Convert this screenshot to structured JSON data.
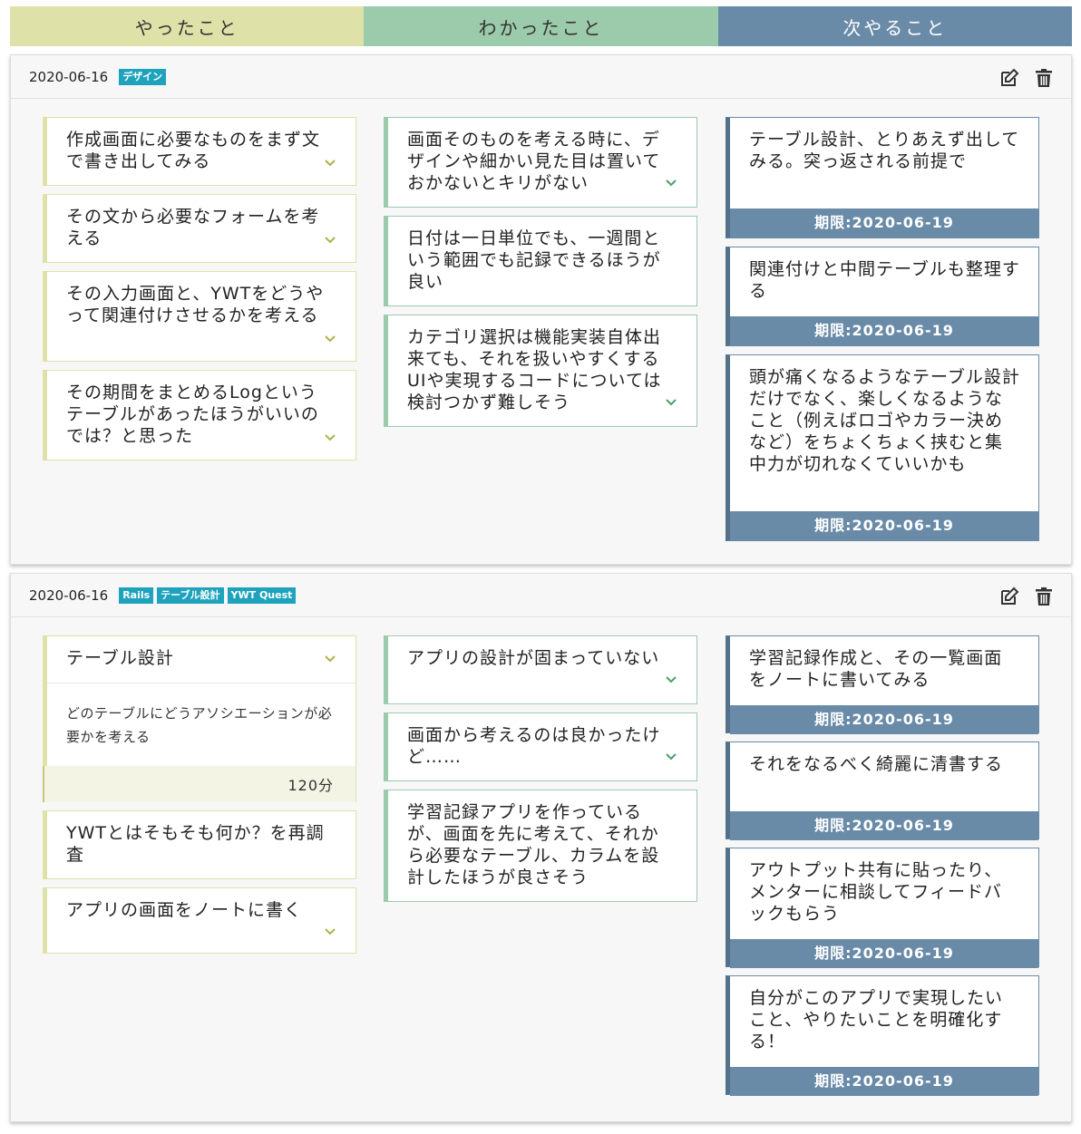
{
  "header": {
    "yatta": "やったこと",
    "wakatta": "わかったこと",
    "tsugi": "次やること"
  },
  "colors": {
    "yatta": "#dfe2a8",
    "wakatta": "#9ccbab",
    "tsugi": "#6a8ba8",
    "tag": "#1fa3bd"
  },
  "cards": [
    {
      "date": "2020-06-16",
      "tags": [
        "デザイン"
      ],
      "yatta": [
        "作成画面に必要なものをまず文で書き出してみる",
        "その文から必要なフォームを考える",
        "その入力画面と、YWTをどうやって関連付けさせるかを考える",
        "その期間をまとめるLogというテーブルがあったほうがいいのでは？と思った"
      ],
      "wakatta": [
        "画面そのものを考える時に、デザインや細かい見た目は置いておかないとキリがない",
        "日付は一日単位でも、一週間という範囲でも記録できるほうが良い",
        "カテゴリ選択は機能実装自体出来ても、それを扱いやすくするUIや実現するコードについては検討つかず難しそう"
      ],
      "tsugi": [
        {
          "text": "テーブル設計、とりあえず出してみる。突っ返される前提で",
          "deadline": "期限:2020-06-19"
        },
        {
          "text": "関連付けと中間テーブルも整理する",
          "deadline": "期限:2020-06-19"
        },
        {
          "text": "頭が痛くなるようなテーブル設計だけでなく、楽しくなるようなこと（例えばロゴやカラー決めなど）をちょくちょく挟むと集中力が切れなくていいかも",
          "deadline": "期限:2020-06-19"
        }
      ]
    },
    {
      "date": "2020-06-16",
      "tags": [
        "Rails",
        "テーブル設計",
        "YWT Quest"
      ],
      "yatta": [
        {
          "text": "テーブル設計",
          "desc": "どのテーブルにどうアソシエーションが必要かを考える",
          "time": "120分"
        },
        "YWTとはそもそも何か？を再調査",
        "アプリの画面をノートに書く"
      ],
      "wakatta": [
        "アプリの設計が固まっていない",
        "画面から考えるのは良かったけど……",
        "学習記録アプリを作っているが、画面を先に考えて、それから必要なテーブル、カラムを設計したほうが良さそう"
      ],
      "tsugi": [
        {
          "text": "学習記録作成と、その一覧画面をノートに書いてみる",
          "deadline": "期限:2020-06-19"
        },
        {
          "text": "それをなるべく綺麗に清書する",
          "deadline": "期限:2020-06-19"
        },
        {
          "text": "アウトプット共有に貼ったり、メンターに相談してフィードバックもらう",
          "deadline": "期限:2020-06-19"
        },
        {
          "text": "自分がこのアプリで実現したいこと、やりたいことを明確化する！",
          "deadline": "期限:2020-06-19"
        }
      ]
    }
  ]
}
